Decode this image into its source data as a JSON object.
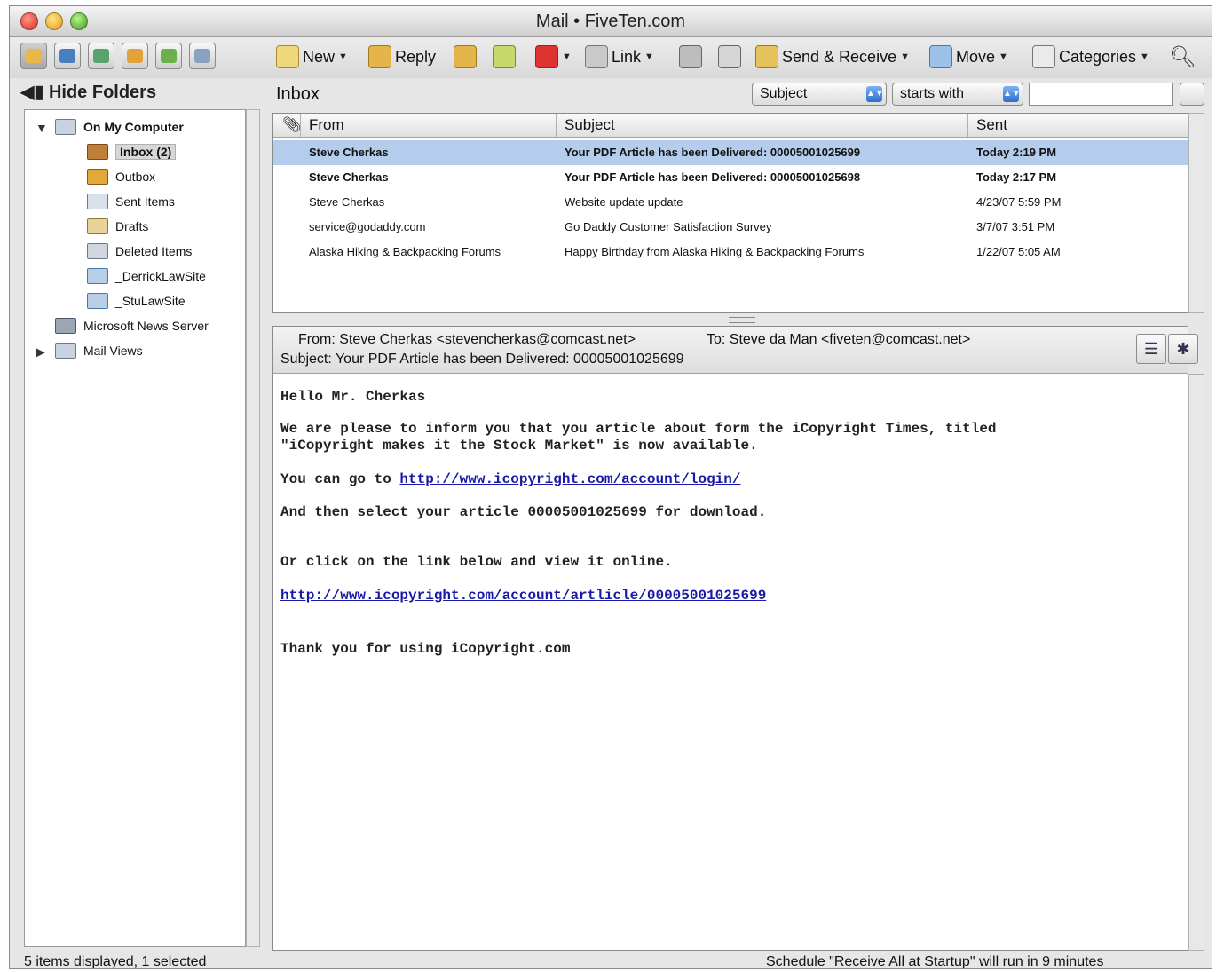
{
  "window": {
    "title": "Mail • FiveTen.com"
  },
  "toolbar": {
    "new_label": "New",
    "reply_label": "Reply",
    "link_label": "Link",
    "send_receive_label": "Send & Receive",
    "move_label": "Move",
    "categories_label": "Categories"
  },
  "sidebar": {
    "hide_folders_label": "Hide Folders",
    "root_label": "On My Computer",
    "folders": [
      {
        "label": "Inbox (2)"
      },
      {
        "label": "Outbox"
      },
      {
        "label": "Sent Items"
      },
      {
        "label": "Drafts"
      },
      {
        "label": "Deleted Items"
      },
      {
        "label": "_DerrickLawSite"
      },
      {
        "label": "_StuLawSite"
      }
    ],
    "news_server_label": "Microsoft News Server",
    "mail_views_label": "Mail Views"
  },
  "list": {
    "folder_title": "Inbox",
    "filter_field": "Subject",
    "filter_op": "starts with",
    "search_value": "",
    "columns": {
      "from": "From",
      "subject": "Subject",
      "sent": "Sent"
    },
    "rows": [
      {
        "from": "Steve Cherkas",
        "subject": "Your PDF Article has been Delivered: 00005001025699",
        "sent": "Today 2:19 PM"
      },
      {
        "from": "Steve Cherkas",
        "subject": "Your PDF Article has been Delivered: 00005001025698",
        "sent": "Today 2:17 PM"
      },
      {
        "from": "Steve Cherkas",
        "subject": "Website update update",
        "sent": "4/23/07 5:59 PM"
      },
      {
        "from": "service@godaddy.com",
        "subject": "Go Daddy Customer Satisfaction Survey",
        "sent": "3/7/07 3:51 PM"
      },
      {
        "from": "Alaska Hiking & Backpacking Forums",
        "subject": "Happy Birthday from Alaska Hiking & Backpacking Forums",
        "sent": "1/22/07 5:05 AM"
      }
    ]
  },
  "preview": {
    "from_line": "From: Steve Cherkas <stevencherkas@comcast.net>",
    "to_line": "To: Steve da Man <fiveten@comcast.net>",
    "subject_line": "Subject: Your PDF Article has been Delivered: 00005001025699",
    "greeting": "Hello Mr. Cherkas",
    "para1_line1": "We are please to inform you that you article about form the iCopyright Times, titled",
    "para1_line2": "\"iCopyright makes it the Stock Market\" is now available.",
    "para2_prefix": "You can go to ",
    "link1": "http://www.icopyright.com/account/login/",
    "para3": "And then select your article 00005001025699 for download.",
    "para4": "Or click on the link below and view it online.",
    "link2": "http://www.icopyright.com/account/artlicle/00005001025699",
    "closing": "Thank you for using iCopyright.com"
  },
  "status": {
    "left": "5 items displayed, 1 selected",
    "right": "Schedule \"Receive All at Startup\" will run in 9 minutes"
  }
}
